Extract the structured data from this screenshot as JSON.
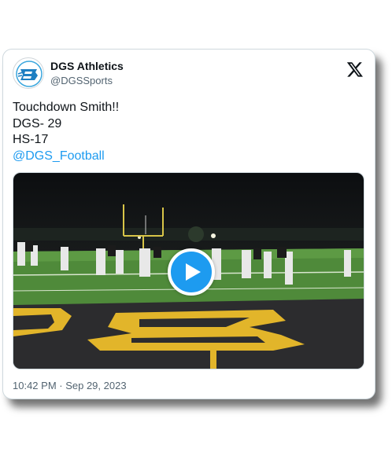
{
  "account": {
    "display_name": "DGS Athletics",
    "handle": "@DGSSports"
  },
  "tweet": {
    "lines": [
      "Touchdown Smith!!",
      "DGS- 29",
      "HS-17"
    ],
    "mention": "@DGS_Football",
    "timestamp": "10:42 PM · Sep 29, 2023"
  },
  "icons": {
    "brand": "x-logo-icon",
    "avatar": "dgs-logo-avatar",
    "play": "play-icon"
  },
  "colors": {
    "link": "#1d9bf0",
    "play_button": "#1d9bf0",
    "text_primary": "#0f1419",
    "text_secondary": "#536471"
  }
}
